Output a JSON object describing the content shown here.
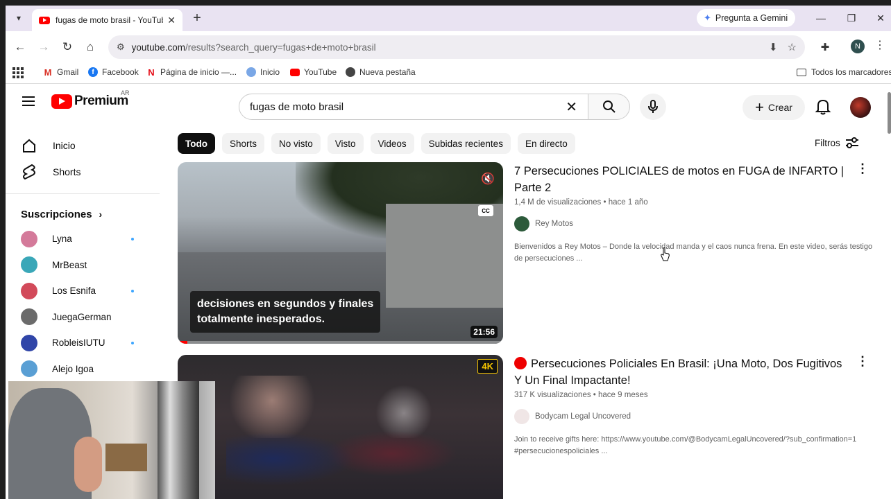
{
  "browser": {
    "tab_title": "fugas de moto brasil - YouTube",
    "gemini_label": "Pregunta a Gemini",
    "url_host": "youtube.com",
    "url_path": "/results?search_query=fugas+de+moto+brasil",
    "profile_initial": "N",
    "bookmarks": [
      "Gmail",
      "Facebook",
      "Página de inicio —...",
      "Inicio",
      "YouTube",
      "Nueva pestaña"
    ],
    "all_bookmarks": "Todos los marcadores"
  },
  "youtube": {
    "logo_text": "Premium",
    "country_code": "AR",
    "search_query": "fugas de moto brasil",
    "create_label": "Crear",
    "filters_label": "Filtros",
    "sidebar": {
      "home": "Inicio",
      "shorts": "Shorts",
      "subscriptions_title": "Suscripciones",
      "subscriptions": [
        {
          "name": "Lyna",
          "new": true,
          "color": "#d47a9a"
        },
        {
          "name": "MrBeast",
          "new": false,
          "color": "#3aa7b8"
        },
        {
          "name": "Los Esnifa",
          "new": true,
          "color": "#d24a5a"
        },
        {
          "name": "JuegaGerman",
          "new": false,
          "color": "#6b6b6b"
        },
        {
          "name": "RobleisIUTU",
          "new": true,
          "color": "#3045a8"
        },
        {
          "name": "Alejo Igoa",
          "new": false,
          "color": "#5a9fd4"
        }
      ]
    },
    "chips": [
      "Todo",
      "Shorts",
      "No visto",
      "Visto",
      "Videos",
      "Subidas recientes",
      "En directo"
    ],
    "results": [
      {
        "title": "7 Persecuciones POLICIALES de motos en FUGA de INFARTO | Parte 2",
        "views": "1,4 M de visualizaciones",
        "age": "hace 1 año",
        "channel": "Rey Motos",
        "description": "Bienvenidos a Rey Motos – Donde la velocidad manda y el caos nunca frena. En este video, serás testigo de persecuciones ...",
        "duration": "21:56",
        "caption_line1": "decisiones en segundos y finales",
        "caption_line2": "totalmente inesperados.",
        "cc_label": "CC",
        "watched_fraction": 0.03
      },
      {
        "title": "Persecuciones Policiales En Brasil: ¡Una Moto, Dos Fugitivos Y Un Final Impactante!",
        "views": "317 K visualizaciones",
        "age": "hace 9 meses",
        "channel": "Bodycam Legal Uncovered",
        "description": "Join to receive gifts here: https://www.youtube.com/@BodycamLegalUncovered/?sub_confirmation=1 #persecucionespoliciales ...",
        "badge": "4K"
      }
    ]
  }
}
